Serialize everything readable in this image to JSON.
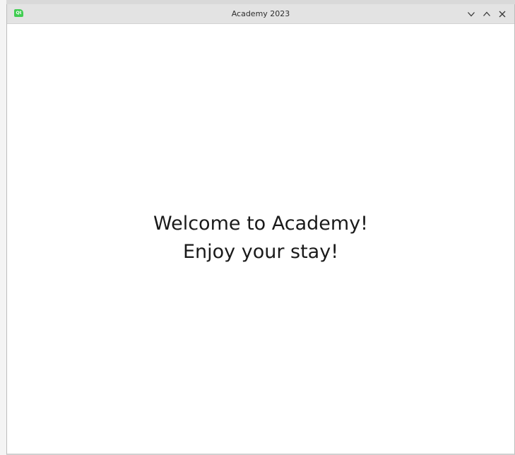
{
  "window": {
    "title": "Academy 2023",
    "app_icon_text": "Qt",
    "controls": {
      "minimize_icon": "chevron-down-icon",
      "maximize_icon": "chevron-up-icon",
      "close_icon": "close-icon"
    }
  },
  "main": {
    "welcome_line1": "Welcome to Academy!",
    "welcome_line2": "Enjoy your stay!"
  },
  "colors": {
    "titlebar_bg": "#e3e3e3",
    "content_bg": "#ffffff",
    "qt_icon": "#41cd52",
    "text": "#1a1a1a"
  }
}
